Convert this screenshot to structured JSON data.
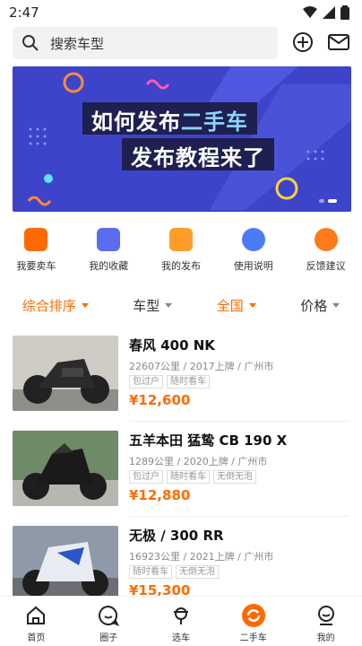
{
  "status_bar": {
    "time": "2:47"
  },
  "search": {
    "placeholder": "搜索车型"
  },
  "banner": {
    "line1_a": "如何发布",
    "line1_b": "二手车",
    "line2": "发布教程来了"
  },
  "quick_nav": [
    {
      "label": "我要卖车",
      "icon": "sell-car-icon",
      "color": "#ff6a00"
    },
    {
      "label": "我的收藏",
      "icon": "favorites-icon",
      "color": "#5b6cf0"
    },
    {
      "label": "我的发布",
      "icon": "my-posts-icon",
      "color": "#ff9c2a"
    },
    {
      "label": "使用说明",
      "icon": "instructions-icon",
      "color": "#4a7cf5"
    },
    {
      "label": "反馈建议",
      "icon": "feedback-icon",
      "color": "#ff7a1a"
    }
  ],
  "filters": [
    {
      "label": "综合排序",
      "active": true
    },
    {
      "label": "车型",
      "active": false
    },
    {
      "label": "全国",
      "active": true
    },
    {
      "label": "价格",
      "active": false
    }
  ],
  "listings": [
    {
      "title": "春风 400 NK",
      "meta": "22607公里 / 2017上牌 / 广州市",
      "tags": [
        "包过户",
        "随时看车"
      ],
      "price": "¥12,600"
    },
    {
      "title": "五羊本田 猛鸷 CB 190 X",
      "meta": "1289公里 / 2020上牌 / 广州市",
      "tags": [
        "包过户",
        "随时看车",
        "无倒无泡"
      ],
      "price": "¥12,880"
    },
    {
      "title": "无极 / 300 RR",
      "meta": "16923公里 / 2021上牌 / 广州市",
      "tags": [
        "随时看车",
        "无倒无泡"
      ],
      "price": "¥15,300"
    }
  ],
  "bottom_nav": [
    {
      "label": "首页",
      "icon": "home-icon"
    },
    {
      "label": "圈子",
      "icon": "circle-icon"
    },
    {
      "label": "选车",
      "icon": "choose-car-icon"
    },
    {
      "label": "二手车",
      "icon": "used-car-icon",
      "active": true
    },
    {
      "label": "我的",
      "icon": "profile-icon"
    }
  ],
  "colors": {
    "accent": "#ff6a00",
    "banner_bg": "#3d44c9"
  }
}
